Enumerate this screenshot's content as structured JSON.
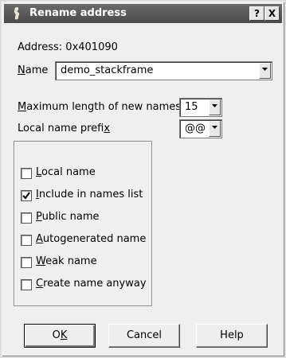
{
  "window": {
    "title": "Rename address",
    "help_btn": "?",
    "close_btn": "X"
  },
  "address": {
    "label": "Address:",
    "value": "0x401090"
  },
  "name": {
    "label_u": "N",
    "label_rest": "ame",
    "value": "demo_stackframe"
  },
  "max_length": {
    "label_u": "M",
    "label_rest": "aximum length of new names",
    "value": "15"
  },
  "prefix": {
    "label_pre": "Local name prefi",
    "label_u": "x",
    "value": "@@"
  },
  "options": [
    {
      "u": "L",
      "rest": "ocal name",
      "checked": false
    },
    {
      "u": "I",
      "rest": "nclude in names list",
      "checked": true
    },
    {
      "u": "P",
      "rest": "ublic name",
      "checked": false
    },
    {
      "u": "A",
      "rest": "utogenerated name",
      "checked": false
    },
    {
      "u": "W",
      "rest": "eak name",
      "checked": false
    },
    {
      "u": "C",
      "rest": "reate name anyway",
      "checked": false
    }
  ],
  "buttons": {
    "ok_pre": "O",
    "ok_u": "K",
    "cancel": "Cancel",
    "help": "Help"
  }
}
